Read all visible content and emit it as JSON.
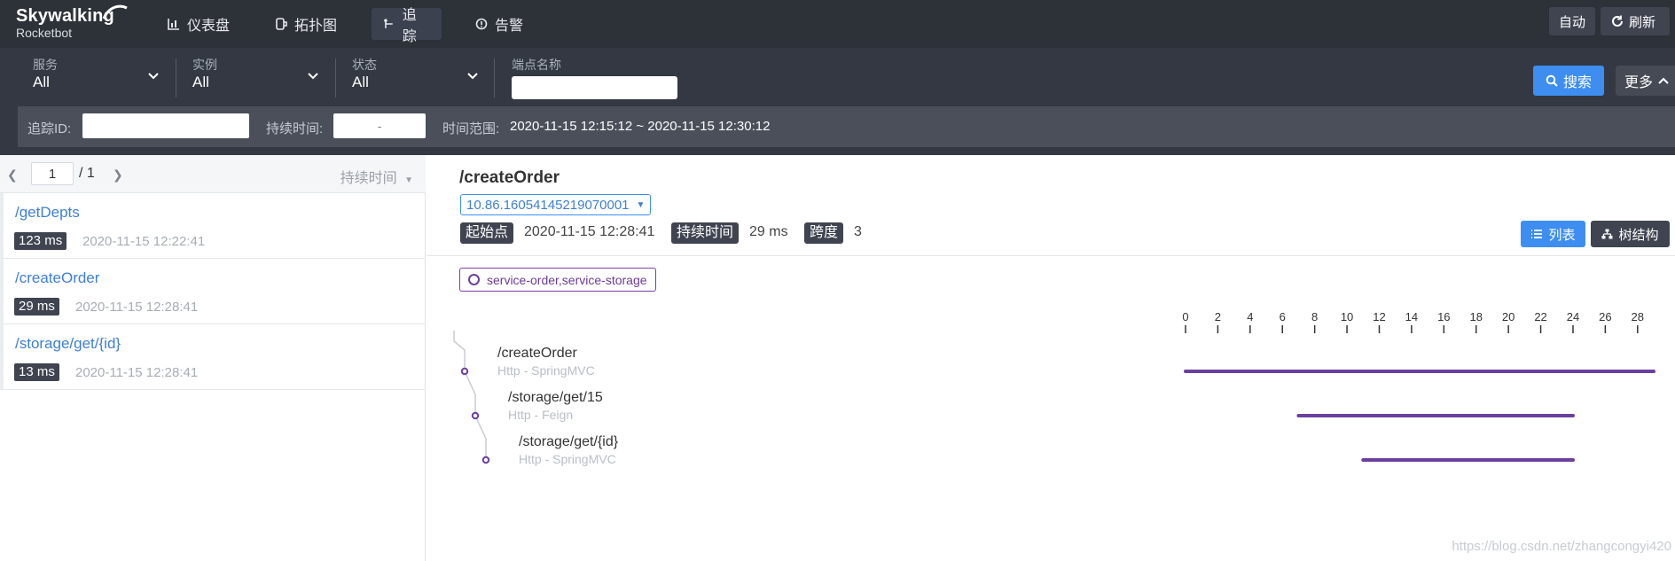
{
  "brand": {
    "name": "Skywalking",
    "sub": "Rocketbot"
  },
  "nav": [
    {
      "label": "仪表盘",
      "icon": "chart-icon"
    },
    {
      "label": "拓扑图",
      "icon": "topology-icon"
    },
    {
      "label": "追踪",
      "icon": "trace-icon",
      "active": true
    },
    {
      "label": "告警",
      "icon": "alarm-icon"
    }
  ],
  "top_buttons": {
    "auto": "自动",
    "refresh": "刷新"
  },
  "filters": {
    "service": {
      "label": "服务",
      "value": "All"
    },
    "instance": {
      "label": "实例",
      "value": "All"
    },
    "state": {
      "label": "状态",
      "value": "All"
    },
    "endpoint": {
      "label": "端点名称",
      "value": ""
    },
    "search": "搜索",
    "more": "更多"
  },
  "filters2": {
    "trace_id_label": "追踪ID:",
    "trace_id_value": "",
    "duration_label": "持续时间:",
    "duration_placeholder": "-",
    "time_range_label": "时间范围:",
    "time_range_value": "2020-11-15 12:15:12 ~ 2020-11-15 12:30:12"
  },
  "pager": {
    "page": "1",
    "total": "/ 1",
    "sort": "持续时间"
  },
  "traces": [
    {
      "endpoint": "/getDepts",
      "duration": "123 ms",
      "time": "2020-11-15 12:22:41"
    },
    {
      "endpoint": "/createOrder",
      "duration": "29 ms",
      "time": "2020-11-15 12:28:41"
    },
    {
      "endpoint": "/storage/get/{id}",
      "duration": "13 ms",
      "time": "2020-11-15 12:28:41"
    }
  ],
  "detail": {
    "title": "/createOrder",
    "trace_id": "10.86.16054145219070001",
    "start_label": "起始点",
    "start_value": "2020-11-15 12:28:41",
    "duration_label": "持续时间",
    "duration_value": "29 ms",
    "span_label": "跨度",
    "span_value": "3",
    "list_button": "列表",
    "tree_button": "树结构",
    "services": "service-order,service-storage"
  },
  "chart_data": {
    "type": "bar",
    "title": "",
    "xlabel": "",
    "ylabel": "",
    "xlim": [
      0,
      29
    ],
    "ticks": [
      0,
      2,
      4,
      6,
      8,
      10,
      12,
      14,
      16,
      18,
      20,
      22,
      24,
      26,
      28
    ],
    "spans": [
      {
        "name": "/createOrder",
        "component": "Http - SpringMVC",
        "start": 0,
        "end": 29,
        "depth": 0
      },
      {
        "name": "/storage/get/15",
        "component": "Http - Feign",
        "start": 7,
        "end": 24,
        "depth": 1
      },
      {
        "name": "/storage/get/{id}",
        "component": "Http - SpringMVC",
        "start": 11,
        "end": 24,
        "depth": 2
      }
    ],
    "color": "#6b3fa0"
  },
  "watermark": "https://blog.csdn.net/zhangcongyi420"
}
